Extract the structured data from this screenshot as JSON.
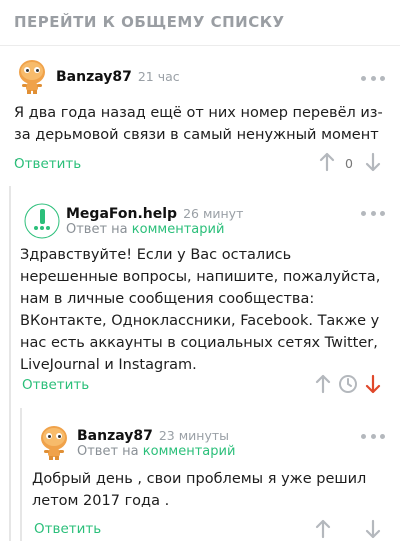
{
  "header": {
    "title": "ПЕРЕЙТИ К ОБЩЕМУ СПИСКУ"
  },
  "comments": [
    {
      "author": "Banzay87",
      "time": "21 час",
      "text": "Я два года назад ещё от них номер перевёл из-за дерьмовой связи в самый ненужный момент .",
      "reply_label": "Ответить",
      "score": "0"
    },
    {
      "author": "MegaFon.help",
      "time": "26 минут",
      "reply_prefix": "Ответ на",
      "reply_link": "комментарий",
      "text": "Здравствуйте! Если у Вас остались нерешенные вопросы, напишите, пожалуйста, нам в личные сообщения сообщества: ВКонтакте, Одноклассники, Facebook. Также у нас есть аккаунты в социальных сетях Twitter, LiveJournal и Instagram.",
      "reply_label": "Ответить"
    },
    {
      "author": "Banzay87",
      "time": "23 минуты",
      "reply_prefix": "Ответ на",
      "reply_link": "комментарий",
      "text": "Добрый день , свои проблемы я уже решил летом 2017 года .",
      "reply_label": "Ответить"
    }
  ],
  "colors": {
    "accent": "#2bbf7a",
    "downvote_active": "#e0482b",
    "muted": "#b4b8bd"
  }
}
